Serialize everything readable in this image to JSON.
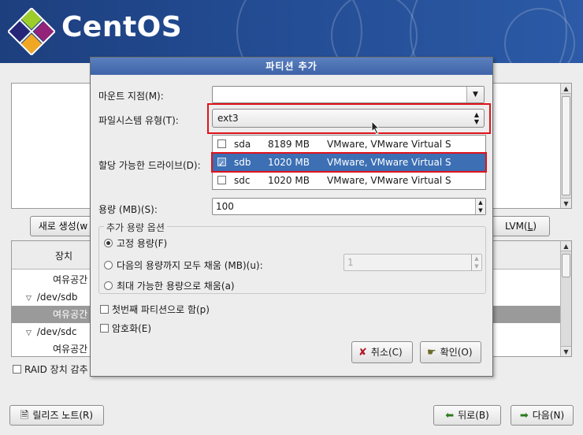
{
  "brand": {
    "name": "CentOS"
  },
  "background": {
    "create_button": "새로 생성(w",
    "create_key": "w",
    "lvm_button": "LVM(L)",
    "lvm_label": "LVM(",
    "lvm_key": "L",
    "tree_header": "장치",
    "tree_rows": [
      "여유공간",
      "/dev/sdb",
      "여유공간",
      "/dev/sdc",
      "여유공간"
    ],
    "raid_label": "RAID 장치 감추",
    "release_notes_button": "릴리즈 노트(R)",
    "back_button": "뒤로(B)",
    "next_button": "다음(N)"
  },
  "dialog": {
    "title": "파티션 추가",
    "mount_label": "마운트 지점(M):",
    "mount_value": "",
    "fstype_label": "파일시스템 유형(T):",
    "fstype_value": "ext3",
    "drives_label": "할당 가능한 드라이브(D):",
    "drives": [
      {
        "checked": false,
        "name": "sda",
        "size": "8189 MB",
        "model": "VMware, VMware Virtual S"
      },
      {
        "checked": true,
        "name": "sdb",
        "size": "1020 MB",
        "model": "VMware, VMware Virtual S"
      },
      {
        "checked": false,
        "name": "sdc",
        "size": "1020 MB",
        "model": "VMware, VMware Virtual S"
      }
    ],
    "size_label": "용량 (MB)(S):",
    "size_value": "100",
    "options_group": "추가 용량 옵션",
    "opt_fixed": "고정 용량(F)",
    "opt_fill_upto": "다음의 용량까지 모두 채움 (MB)(u):",
    "opt_fill_upto_value": "1",
    "opt_fill_max": "최대 가능한 용량으로 채움(a)",
    "primary_label": "첫번째 파티션으로 함(p)",
    "encrypt_label": "암호화(E)",
    "cancel_button": "취소(C)",
    "ok_button": "확인(O)"
  },
  "colors": {
    "highlight": "#e0121a",
    "selection": "#3c6fb4",
    "banner": "#234c93"
  }
}
